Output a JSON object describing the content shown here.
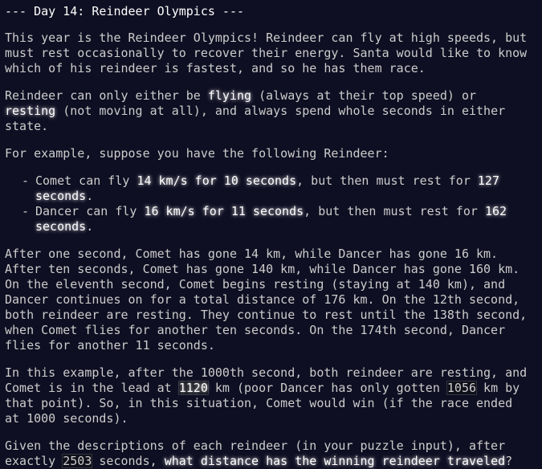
{
  "title": "--- Day 14: Reindeer Olympics ---",
  "p1": "This year is the Reindeer Olympics! Reindeer can fly at high speeds, but must rest occasionally to recover their energy. Santa would like to know which of his reindeer is fastest, and so he has them race.",
  "p2": {
    "a": "Reindeer can only either be ",
    "flying": "flying",
    "b": " (always at their top speed) or ",
    "resting": "resting",
    "c": " (not moving at all), and always spend whole seconds in either state."
  },
  "p3": "For example, suppose you have the following Reindeer:",
  "list": [
    {
      "a": "Comet can fly ",
      "speed": "14 km/s for 10 seconds",
      "b": ", but then must rest for ",
      "rest": "127 seconds",
      "c": "."
    },
    {
      "a": "Dancer can fly ",
      "speed": "16 km/s for 11 seconds",
      "b": ", but then must rest for ",
      "rest": "162 seconds",
      "c": "."
    }
  ],
  "p4": "After one second, Comet has gone 14 km, while Dancer has gone 16 km. After ten seconds, Comet has gone 140 km, while Dancer has gone 160 km. On the eleventh second, Comet begins resting (staying at 140 km), and Dancer continues on for a total distance of 176 km. On the 12th second, both reindeer are resting. They continue to rest until the 138th second, when Comet flies for another ten seconds. On the 174th second, Dancer flies for another 11 seconds.",
  "p5": {
    "a": "In this example, after the 1000th second, both reindeer are resting, and Comet is in the lead at ",
    "comet": "1120",
    "b": " km (poor Dancer has only gotten ",
    "dancer": "1056",
    "c": " km by that point). So, in this situation, Comet would win (if the race ended at 1000 seconds)."
  },
  "p6": {
    "a": "Given the descriptions of each reindeer (in your puzzle input), after exactly ",
    "seconds": "2503",
    "b": " seconds, ",
    "question": "what distance has the winning reindeer traveled",
    "c": "?"
  }
}
